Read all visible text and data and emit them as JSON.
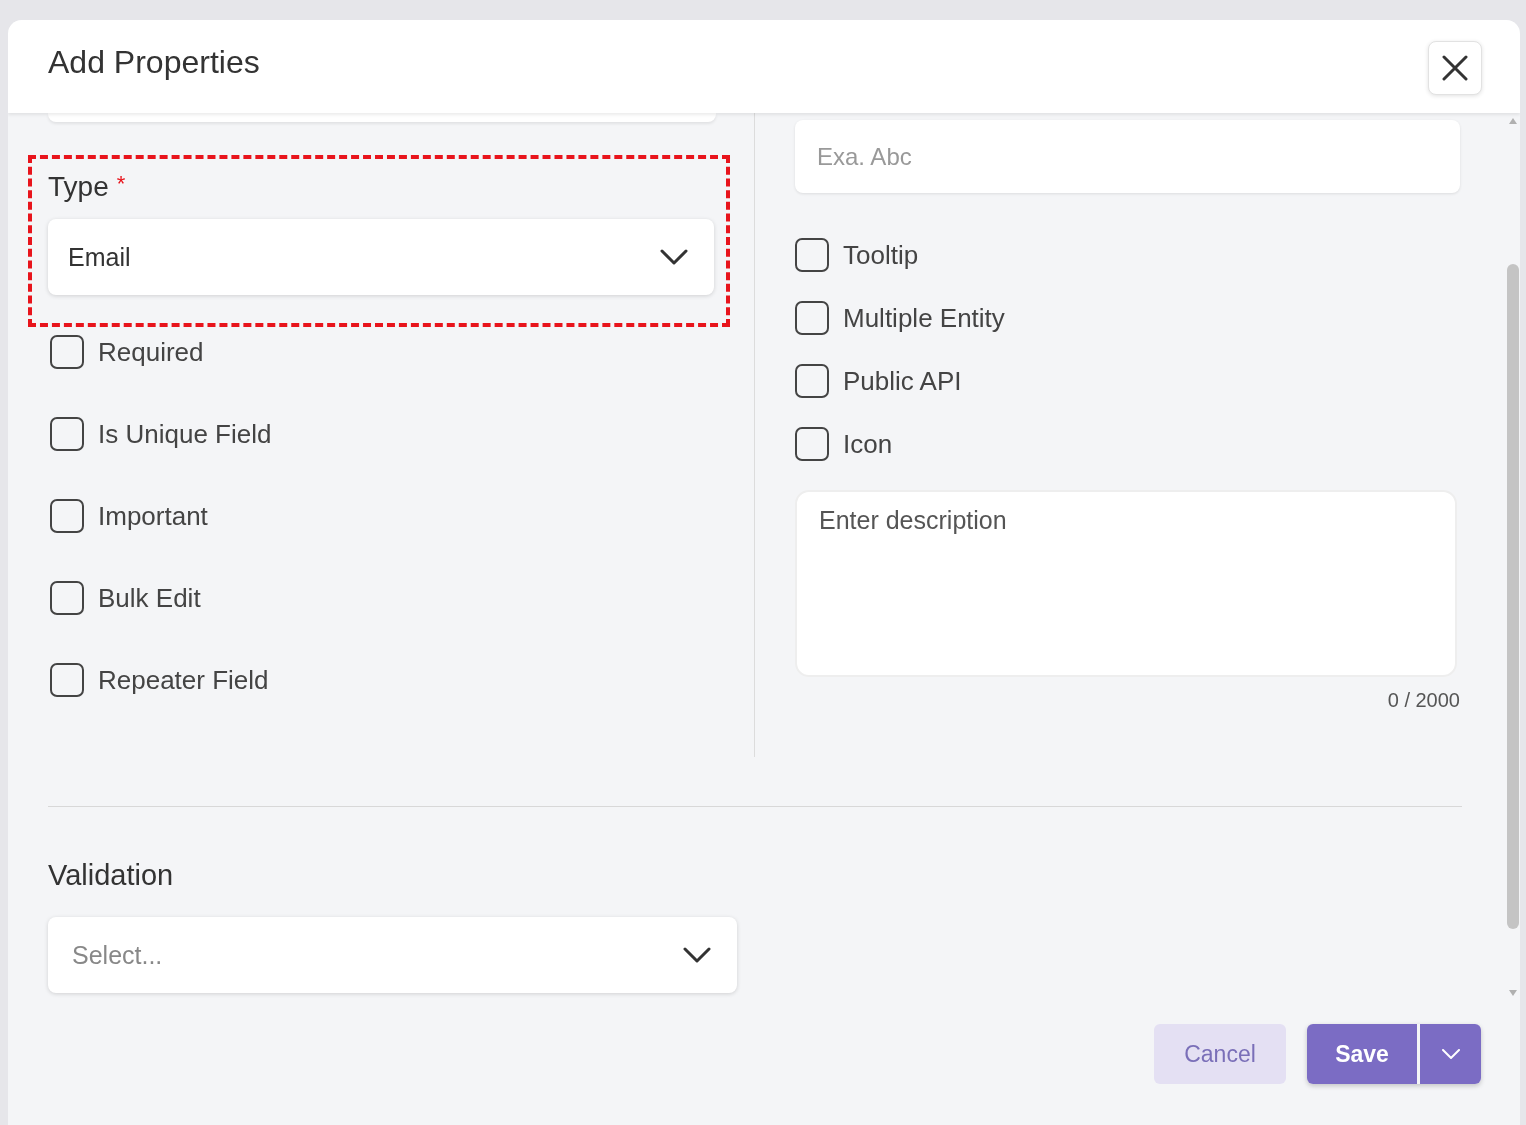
{
  "dialog": {
    "title": "Add Properties"
  },
  "type_field": {
    "label": "Type",
    "required_mark": "*",
    "value": "Email"
  },
  "name_field": {
    "placeholder": "Exa. Abc"
  },
  "left_options": [
    {
      "label": "Required",
      "checked": false
    },
    {
      "label": "Is Unique Field",
      "checked": false
    },
    {
      "label": "Important",
      "checked": false
    },
    {
      "label": "Bulk Edit",
      "checked": false
    },
    {
      "label": "Repeater Field",
      "checked": false
    }
  ],
  "right_options": [
    {
      "label": "Tooltip",
      "checked": false
    },
    {
      "label": "Multiple Entity",
      "checked": false
    },
    {
      "label": "Public API",
      "checked": false
    },
    {
      "label": "Icon",
      "checked": false
    }
  ],
  "description": {
    "placeholder": "Enter description",
    "counter": "0 / 2000"
  },
  "validation": {
    "label": "Validation",
    "placeholder": "Select..."
  },
  "buttons": {
    "cancel": "Cancel",
    "save": "Save"
  }
}
